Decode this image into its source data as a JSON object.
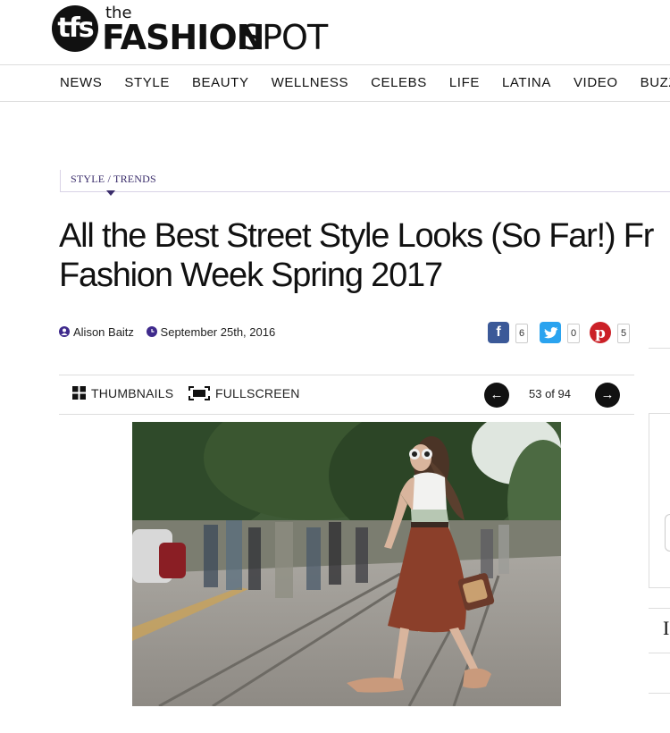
{
  "header": {
    "logo_badge": "tfs",
    "logo_the": "the",
    "logo_fashion": "FASHION",
    "logo_spot": "SPOT"
  },
  "nav": {
    "items": [
      "NEWS",
      "STYLE",
      "BEAUTY",
      "WELLNESS",
      "CELEBS",
      "LIFE",
      "LATINA",
      "VIDEO",
      "BUZZ"
    ]
  },
  "article": {
    "breadcrumb": "STYLE / TRENDS",
    "title_line1": "All the Best Street Style Looks (So Far!) Fr",
    "title_line2": "Fashion Week Spring 2017",
    "author": "Alison Baitz",
    "date": "September 25th, 2016",
    "author_icon": "person-icon",
    "date_icon": "clock-icon"
  },
  "share": {
    "facebook_count": "6",
    "twitter_count": "0",
    "pinterest_count": "5",
    "colors": {
      "facebook": "#3b5998",
      "twitter": "#2aa3ef",
      "pinterest": "#cb2027"
    }
  },
  "gallery": {
    "thumbnails_label": "THUMBNAILS",
    "fullscreen_label": "FULLSCREEN",
    "prev_glyph": "←",
    "next_glyph": "→",
    "counter": "53 of 94",
    "current": 53,
    "total": 94
  },
  "sidebar": {
    "letter": "I"
  },
  "colors": {
    "accent": "#3a2d6b",
    "divider": "#dddddd"
  }
}
